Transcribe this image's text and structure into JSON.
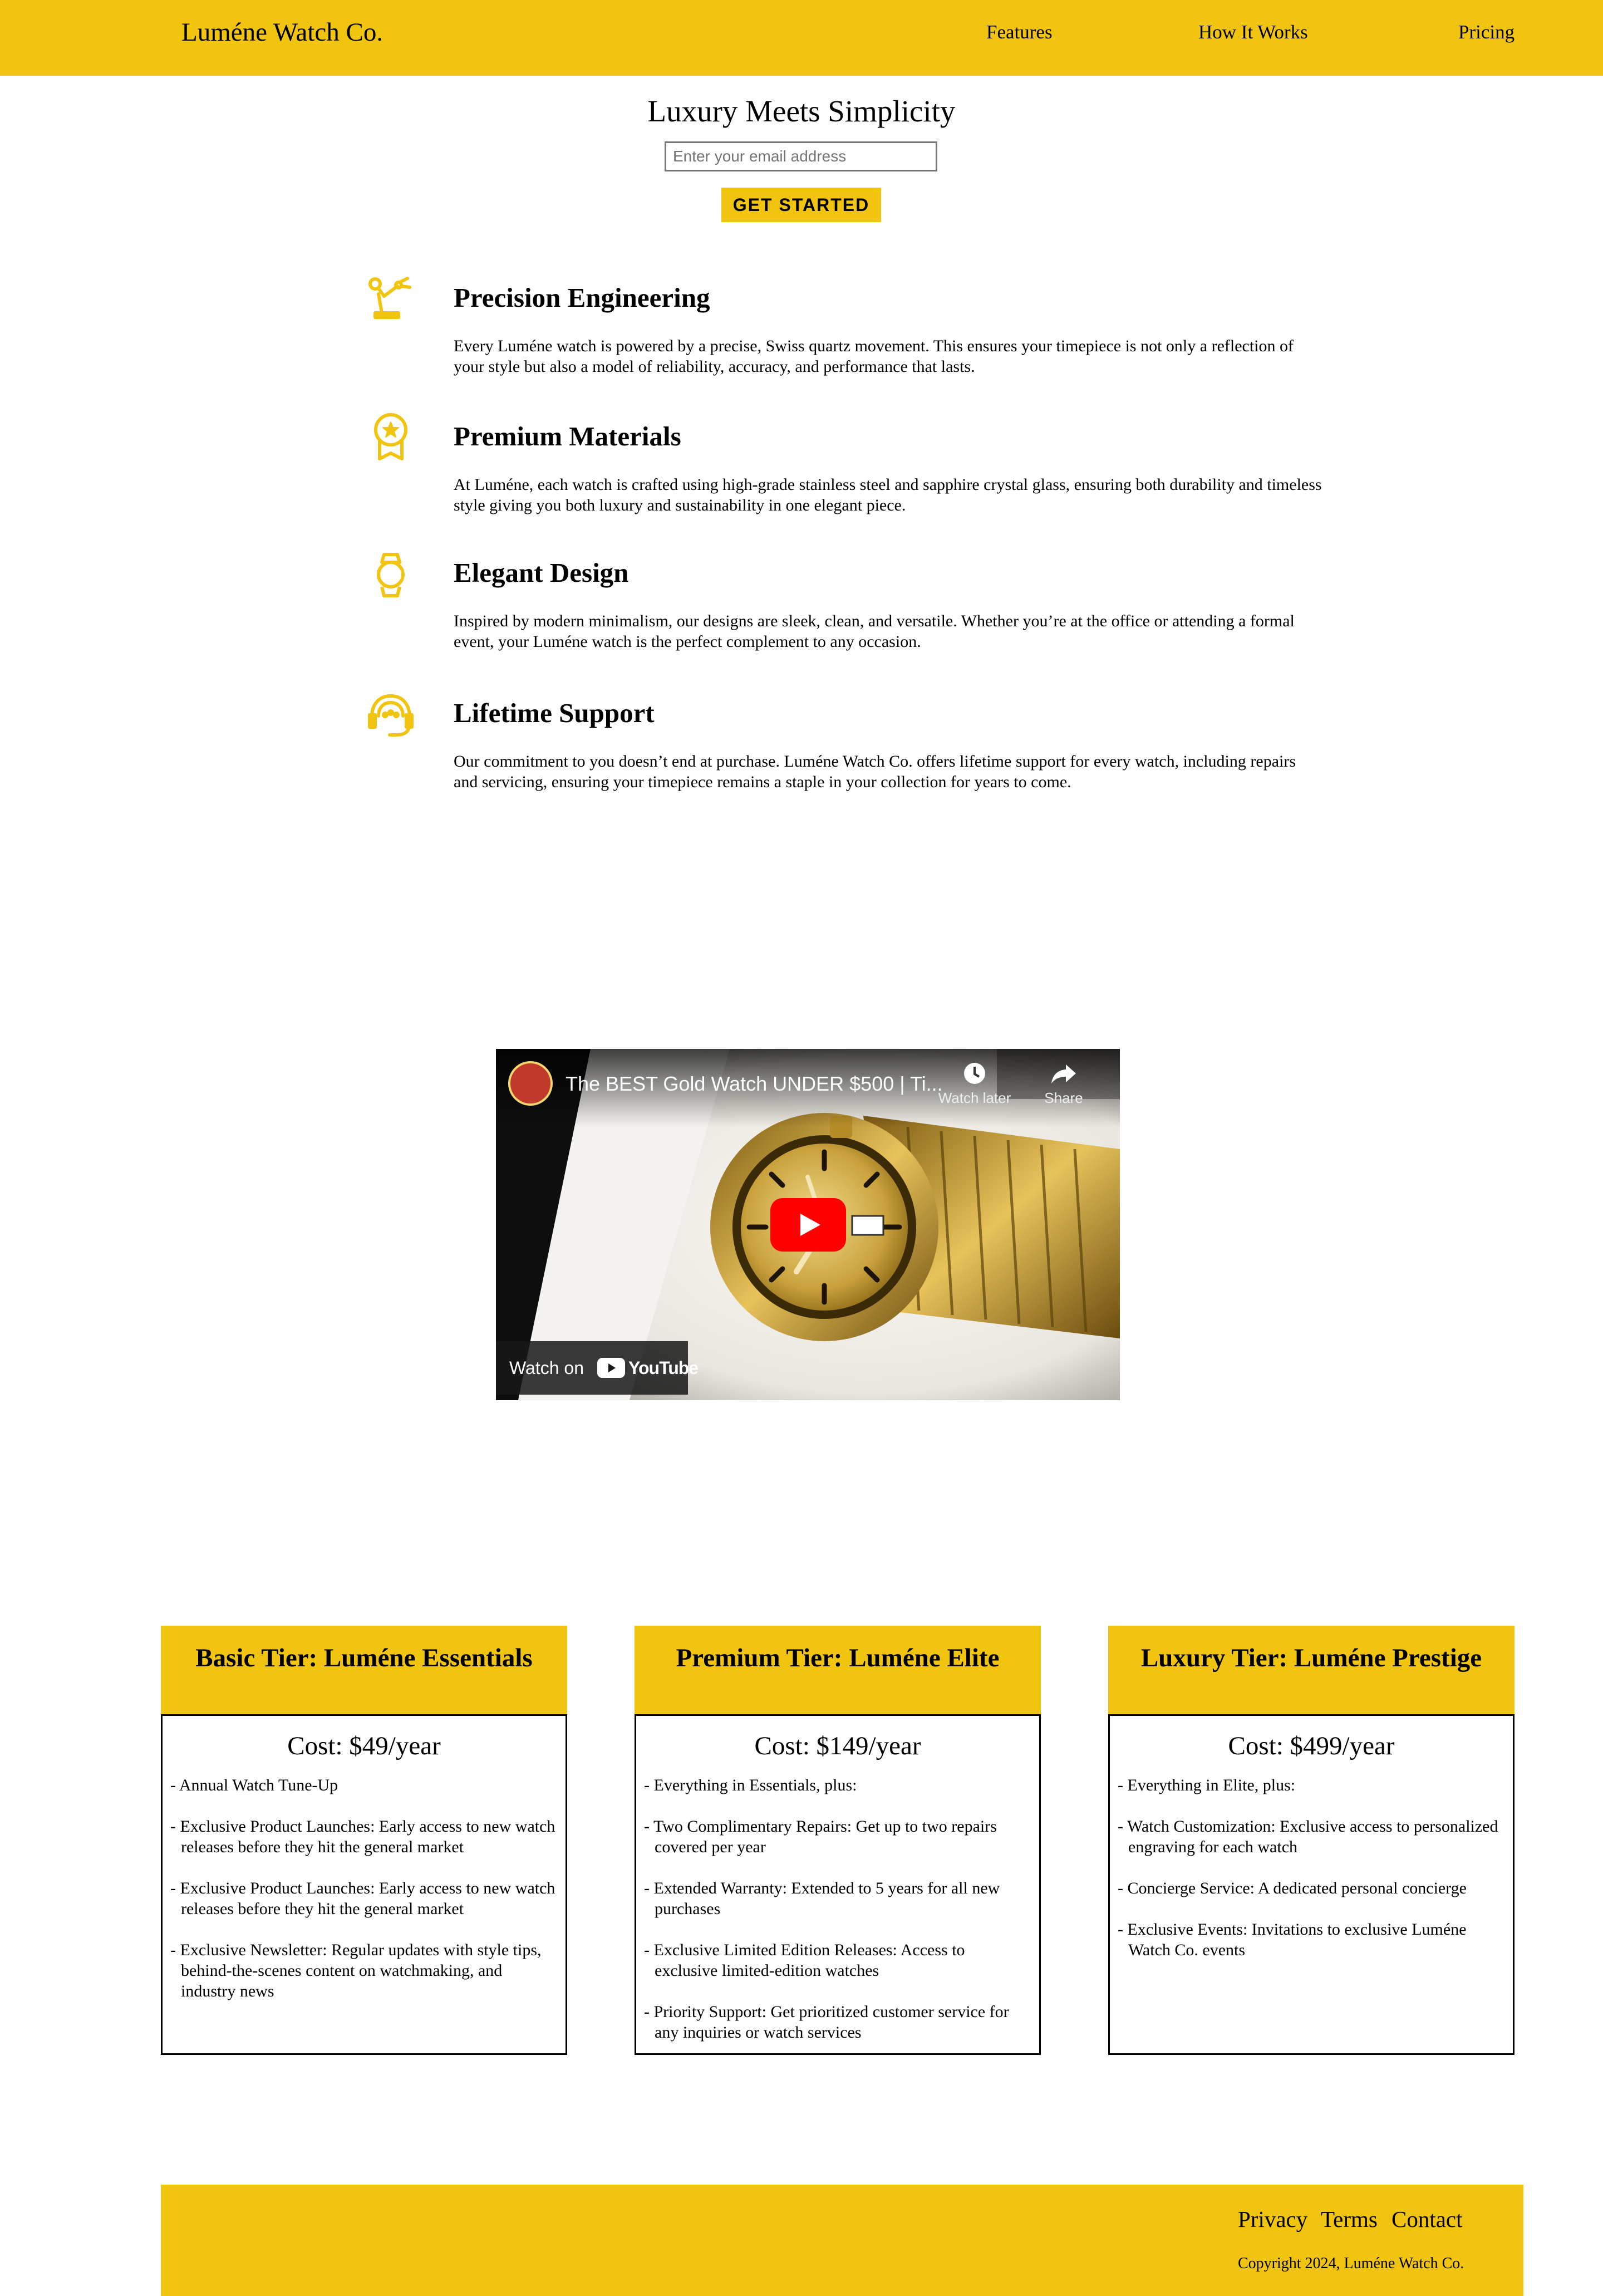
{
  "header": {
    "logo": "Luméne Watch Co.",
    "nav": [
      {
        "label": "Features"
      },
      {
        "label": "How It Works"
      },
      {
        "label": "Pricing"
      }
    ]
  },
  "hero": {
    "title": "Luxury Meets Simplicity",
    "email_placeholder": "Enter your email address",
    "email_value": "",
    "cta_label": "GET STARTED"
  },
  "features": [
    {
      "icon": "robotic-arm-icon",
      "title": "Precision Engineering",
      "text": "Every Luméne watch is powered by a precise, Swiss quartz movement. This ensures your timepiece is not only a reflection of your style but also a model of reliability, accuracy, and performance that lasts."
    },
    {
      "icon": "award-ribbon-icon",
      "title": "Premium Materials",
      "text": "At Luméne, each watch is crafted using high-grade stainless steel and sapphire crystal glass, ensuring both durability and timeless style giving you both luxury and sustainability in one elegant piece."
    },
    {
      "icon": "wristwatch-icon",
      "title": "Elegant Design",
      "text": "Inspired by modern minimalism, our designs are sleek, clean, and versatile. Whether you’re at the office or attending a formal event, your Luméne watch is the perfect complement to any occasion."
    },
    {
      "icon": "headset-support-icon",
      "title": "Lifetime Support",
      "text": "Our commitment to you doesn’t end at purchase. Luméne Watch Co. offers lifetime support for every watch, including repairs and servicing, ensuring your timepiece remains a staple in your collection for years to come."
    }
  ],
  "video": {
    "title": "The BEST Gold Watch UNDER $500 | Ti...",
    "watch_later": "Watch later",
    "share": "Share",
    "watch_on": "Watch on",
    "brand": "YouTube"
  },
  "pricing": [
    {
      "title": "Basic Tier: Luméne Essentials",
      "cost": "Cost: $49/year",
      "perks": [
        "- Annual Watch Tune-Up",
        "- Exclusive Product Launches: Early access to new watch releases before they hit the general market",
        "- Exclusive Product Launches: Early access to new watch releases before they hit the general market",
        "- Exclusive Newsletter: Regular updates with style tips, behind-the-scenes content on watchmaking, and industry news"
      ]
    },
    {
      "title": "Premium Tier: Luméne Elite",
      "cost": "Cost: $149/year",
      "perks": [
        "- Everything in Essentials, plus:",
        "- Two Complimentary Repairs: Get up to two repairs covered per year",
        "- Extended Warranty: Extended to 5 years for all new purchases",
        "- Exclusive Limited Edition Releases: Access to exclusive limited-edition watches",
        "- Priority Support: Get prioritized customer service for any inquiries or watch services"
      ]
    },
    {
      "title": "Luxury Tier: Luméne Prestige",
      "cost": "Cost: $499/year",
      "perks": [
        "- Everything in Elite, plus:",
        "- Watch Customization: Exclusive access to personalized engraving for each watch",
        "- Concierge Service: A dedicated personal concierge",
        "- Exclusive Events: Invitations to exclusive Luméne Watch Co. events"
      ]
    }
  ],
  "footer": {
    "links": [
      {
        "label": "Privacy"
      },
      {
        "label": "Terms"
      },
      {
        "label": "Contact"
      }
    ],
    "copyright": "Copyright 2024, Luméne Watch Co."
  },
  "colors": {
    "accent": "#F1C40F",
    "youtube_red": "#FF0000"
  }
}
